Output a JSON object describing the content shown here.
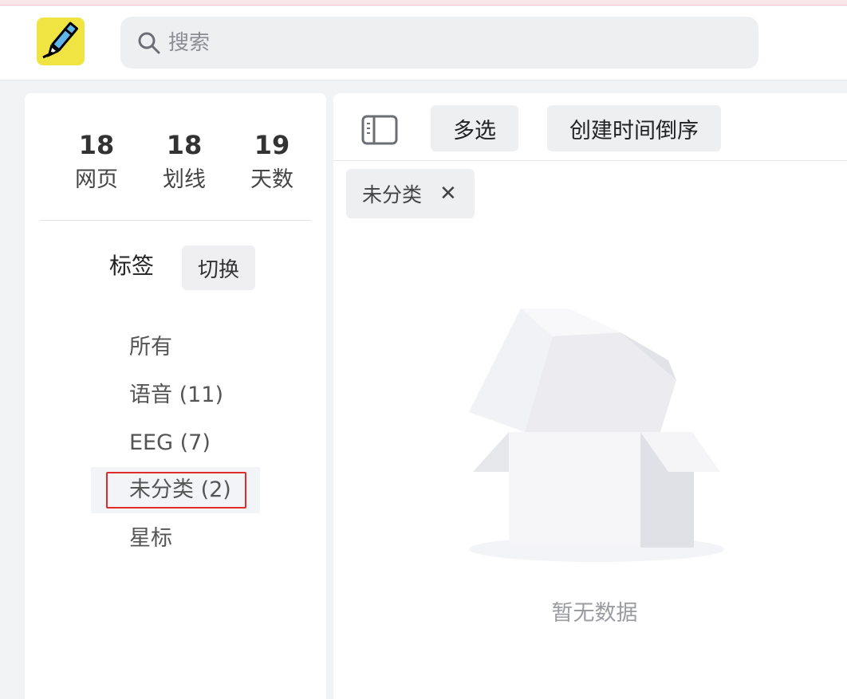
{
  "search": {
    "placeholder": "搜索"
  },
  "stats": [
    {
      "value": "18",
      "label": "网页"
    },
    {
      "value": "18",
      "label": "划线"
    },
    {
      "value": "19",
      "label": "天数"
    }
  ],
  "tags": {
    "title": "标签",
    "switch_label": "切换",
    "items": [
      {
        "label": "所有",
        "active": false
      },
      {
        "label": "语音 (11)",
        "active": false
      },
      {
        "label": "EEG (7)",
        "active": false
      },
      {
        "label": "未分类 (2)",
        "active": true
      },
      {
        "label": "星标",
        "active": false
      }
    ]
  },
  "toolbar": {
    "multi_select_label": "多选",
    "sort_label": "创建时间倒序"
  },
  "filter_chip": {
    "label": "未分类",
    "close_glyph": "✕"
  },
  "empty_state": {
    "text": "暂无数据"
  },
  "colors": {
    "logo_bg": "#f0e442",
    "highlight_border": "#e22b2b",
    "button_bg": "#eeeff1"
  }
}
